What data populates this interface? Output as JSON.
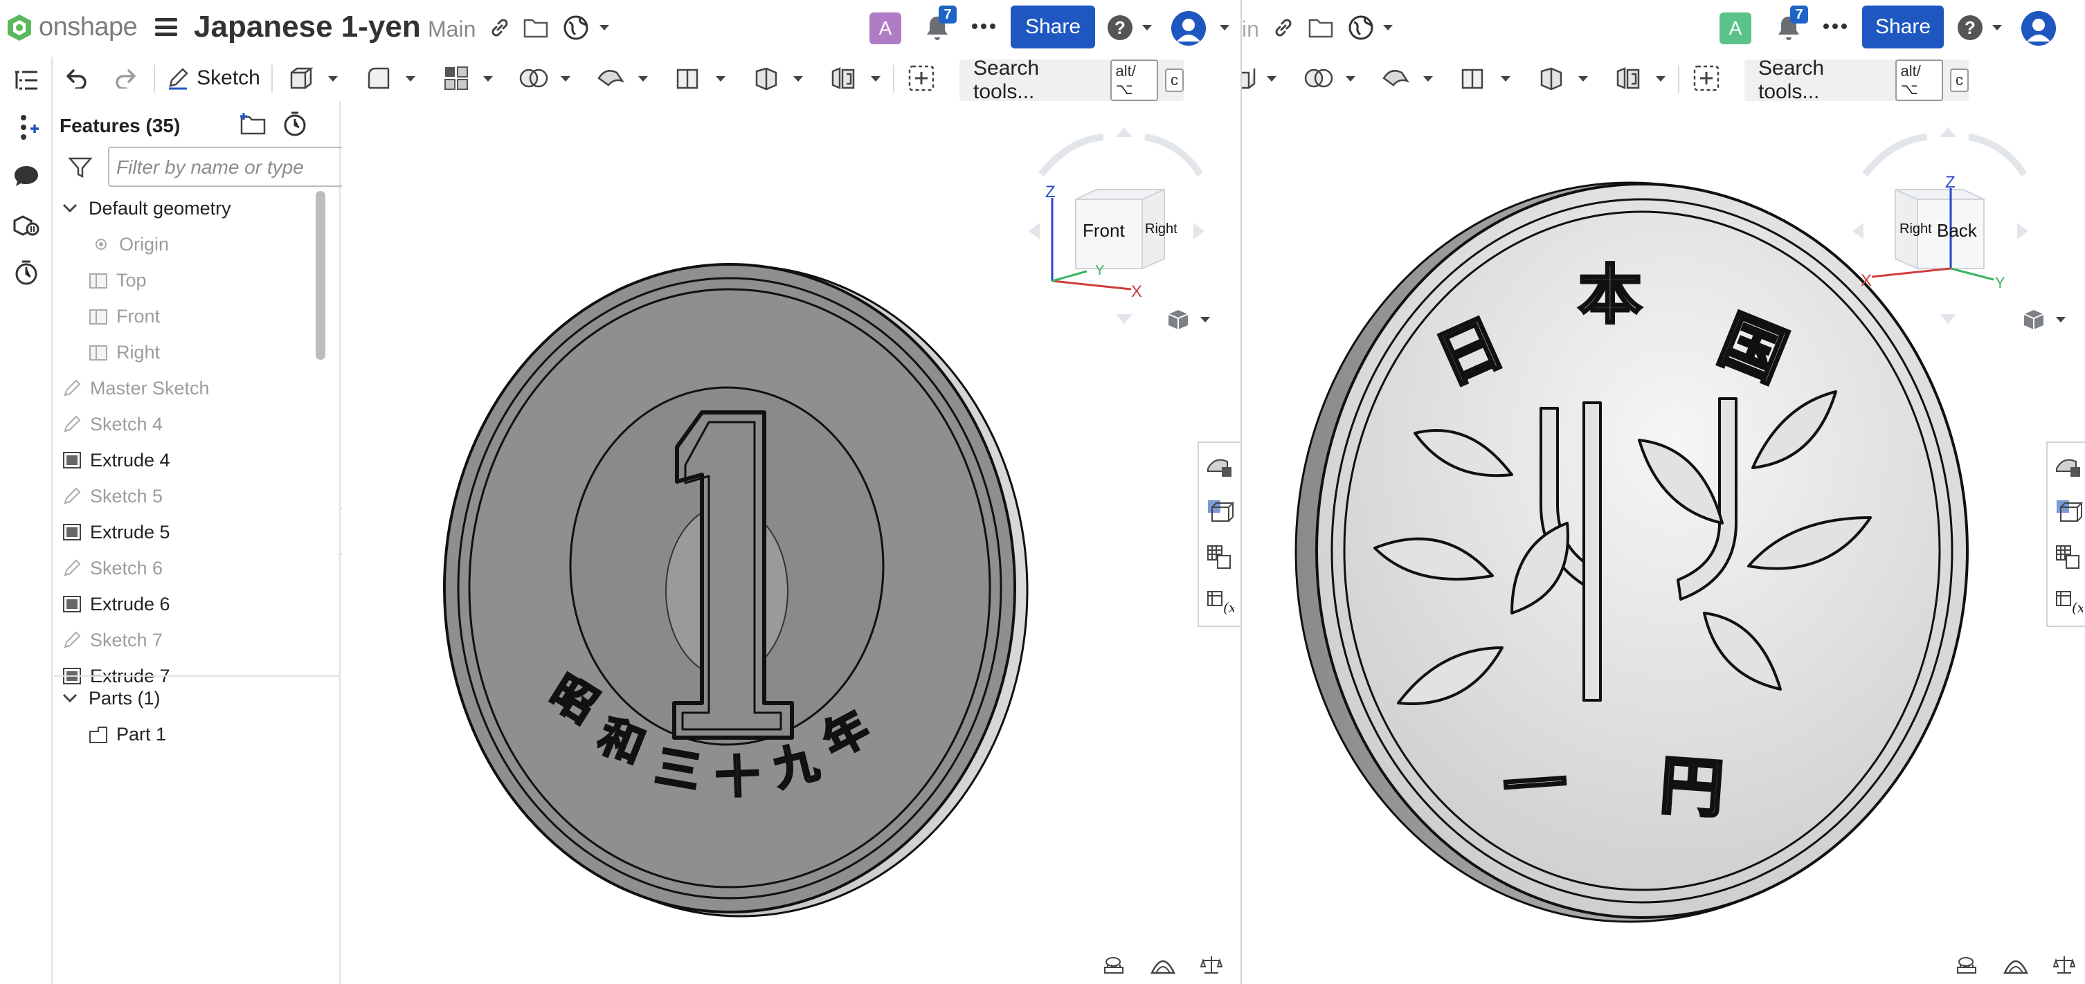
{
  "app": {
    "logo_text": "onshape",
    "document_title": "Japanese 1-yen",
    "branch": "Main",
    "right_title_partial": "in"
  },
  "header": {
    "left": {
      "avatar_letter": "A",
      "avatar_color": "#b07cc6",
      "notifications": "7",
      "share": "Share"
    },
    "right": {
      "avatar_letter": "A",
      "avatar_color": "#5cc28c",
      "notifications": "7",
      "share": "Share"
    }
  },
  "toolbar": {
    "sketch_label": "Sketch",
    "search_tools": "Search tools...",
    "kbd_modifier": "alt/⌥",
    "kbd_key": "c"
  },
  "features": {
    "header": "Features (35)",
    "filter_placeholder": "Filter by name or type",
    "items": [
      {
        "label": "Default geometry",
        "type": "group"
      },
      {
        "label": "Origin",
        "type": "origin"
      },
      {
        "label": "Top",
        "type": "plane"
      },
      {
        "label": "Front",
        "type": "plane"
      },
      {
        "label": "Right",
        "type": "plane"
      },
      {
        "label": "Master Sketch",
        "type": "sketch"
      },
      {
        "label": "Sketch 4",
        "type": "sketch"
      },
      {
        "label": "Extrude 4",
        "type": "extrude"
      },
      {
        "label": "Sketch 5",
        "type": "sketch"
      },
      {
        "label": "Extrude 5",
        "type": "extrude"
      },
      {
        "label": "Sketch 6",
        "type": "sketch"
      },
      {
        "label": "Extrude 6",
        "type": "extrude"
      },
      {
        "label": "Sketch 7",
        "type": "sketch"
      },
      {
        "label": "Extrude 7",
        "type": "extrude"
      }
    ],
    "parts_header": "Parts (1)",
    "parts": [
      {
        "label": "Part 1"
      }
    ]
  },
  "viewcube": {
    "left": {
      "face_main": "Front",
      "face_side": "Right",
      "axis_z": "Z",
      "axis_x": "X",
      "axis_y": "Y"
    },
    "right": {
      "face_main": "Back",
      "face_side": "Right",
      "axis_z": "Z",
      "axis_x": "X",
      "axis_y": "Y"
    }
  },
  "coin": {
    "obverse_numeral": "1",
    "obverse_date_text": "昭和三十九年",
    "reverse_top_text": [
      "日",
      "本",
      "国"
    ],
    "reverse_bottom_text": [
      "一",
      "円"
    ]
  },
  "colors": {
    "accent": "#1e57c0",
    "coin_front_fill": "#8f8f8f",
    "coin_back_fill": "#dcdcdc",
    "axis_x": "#d23c3c",
    "axis_y": "#3cb464",
    "axis_z": "#2846c8"
  }
}
